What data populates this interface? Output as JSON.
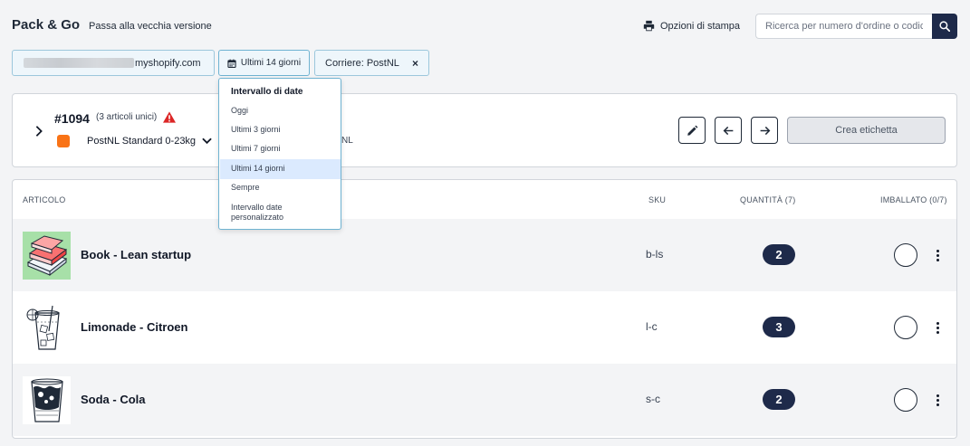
{
  "header": {
    "app_title": "Pack & Go",
    "old_version_link": "Passa alla vecchia versione",
    "print_options": "Opzioni di stampa",
    "search_placeholder": "Ricerca per numero d'ordine o codice a"
  },
  "filters": {
    "shop_suffix": "myshopify.com",
    "date_range": "Ultimi 14 giorni",
    "carrier": "Corriere: PostNL",
    "carrier_clear": "×"
  },
  "date_dropdown": {
    "heading": "Intervallo di date",
    "options": [
      "Oggi",
      "Ultimi 3 giorni",
      "Ultimi 7 giorni",
      "Ultimi 14 giorni",
      "Sempre",
      "Intervallo date personalizzato"
    ],
    "selected": "Ultimi 14 giorni"
  },
  "order": {
    "number": "#1094",
    "units": "(3 articoli unici)",
    "shipping_method": "PostNL Standard 0-23kg",
    "carrier_tail": "NL",
    "create_label_button": "Crea etichetta"
  },
  "table": {
    "headers": {
      "article": "ARTICOLO",
      "sku": "SKU",
      "quantity": "QUANTITÀ (7)",
      "packed": "IMBALLATO (0/7)"
    },
    "rows": [
      {
        "name": "Book - Lean startup",
        "sku": "b-ls",
        "qty": "2"
      },
      {
        "name": "Limonade - Citroen",
        "sku": "l-c",
        "qty": "3"
      },
      {
        "name": "Soda - Cola",
        "sku": "s-c",
        "qty": "2"
      }
    ]
  },
  "colors": {
    "primary": "#1e2a4a",
    "filter_bg": "#eef6fb",
    "filter_border": "#9cc7dc",
    "warning": "#dc2626",
    "dropdown_selected": "#dbeafe"
  },
  "icons": {
    "print": "printer-icon",
    "search": "search-icon",
    "calendar": "calendar-icon",
    "warning": "warning-icon",
    "edit": "pencil-icon",
    "prev": "arrow-left-icon",
    "next": "arrow-right-icon",
    "expand": "chevron-right-icon",
    "menu": "kebab-menu-icon"
  }
}
